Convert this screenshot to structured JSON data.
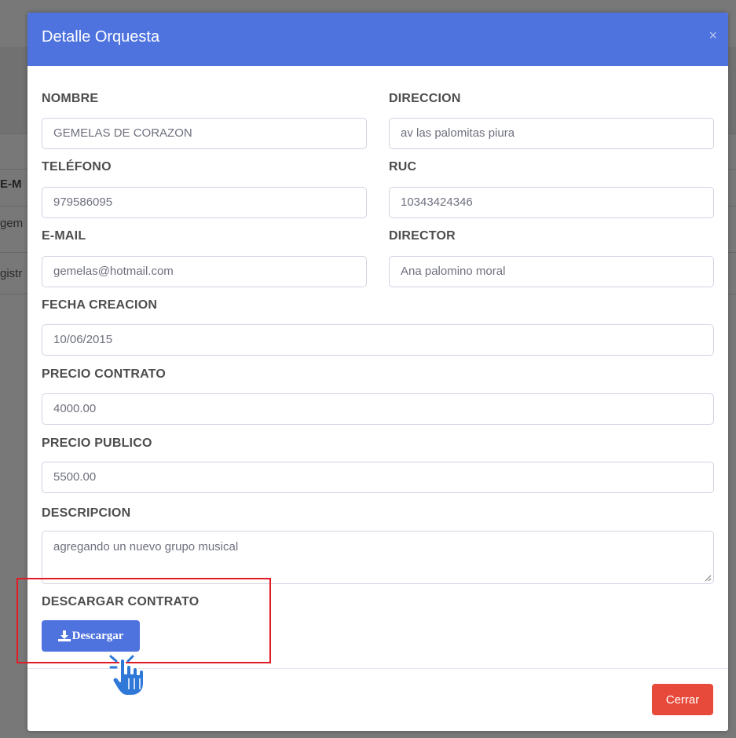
{
  "background": {
    "column_header": "E-M",
    "row_1_text": "gem",
    "row_2_text": "gistr"
  },
  "modal": {
    "title": "Detalle Orquesta",
    "close_symbol": "×",
    "fields": {
      "nombre": {
        "label": "NOMBRE",
        "value": "GEMELAS DE CORAZON"
      },
      "direccion": {
        "label": "DIRECCION",
        "value": "av las palomitas piura"
      },
      "telefono": {
        "label": "TELÉFONO",
        "value": "979586095"
      },
      "ruc": {
        "label": "RUC",
        "value": "10343424346"
      },
      "email": {
        "label": "E-MAIL",
        "value": "gemelas@hotmail.com"
      },
      "director": {
        "label": "DIRECTOR",
        "value": "Ana palomino moral"
      },
      "fecha_creacion": {
        "label": "FECHA CREACION",
        "value": "10/06/2015"
      },
      "precio_contrato": {
        "label": "PRECIO CONTRATO",
        "value": "4000.00"
      },
      "precio_publico": {
        "label": "PRECIO PUBLICO",
        "value": "5500.00"
      },
      "descripcion": {
        "label": "DESCRIPCION",
        "value": "agregando un nuevo grupo musical"
      }
    },
    "download": {
      "section_label": "DESCARGAR CONTRATO",
      "button_label": "Descargar",
      "icon": "download-icon"
    },
    "footer": {
      "close_label": "Cerrar"
    }
  },
  "colors": {
    "header": "#4e73df",
    "primary_button": "#4e73df",
    "danger_button": "#e74a3b",
    "highlight": "#e01b24",
    "cursor": "#2f78d8"
  }
}
